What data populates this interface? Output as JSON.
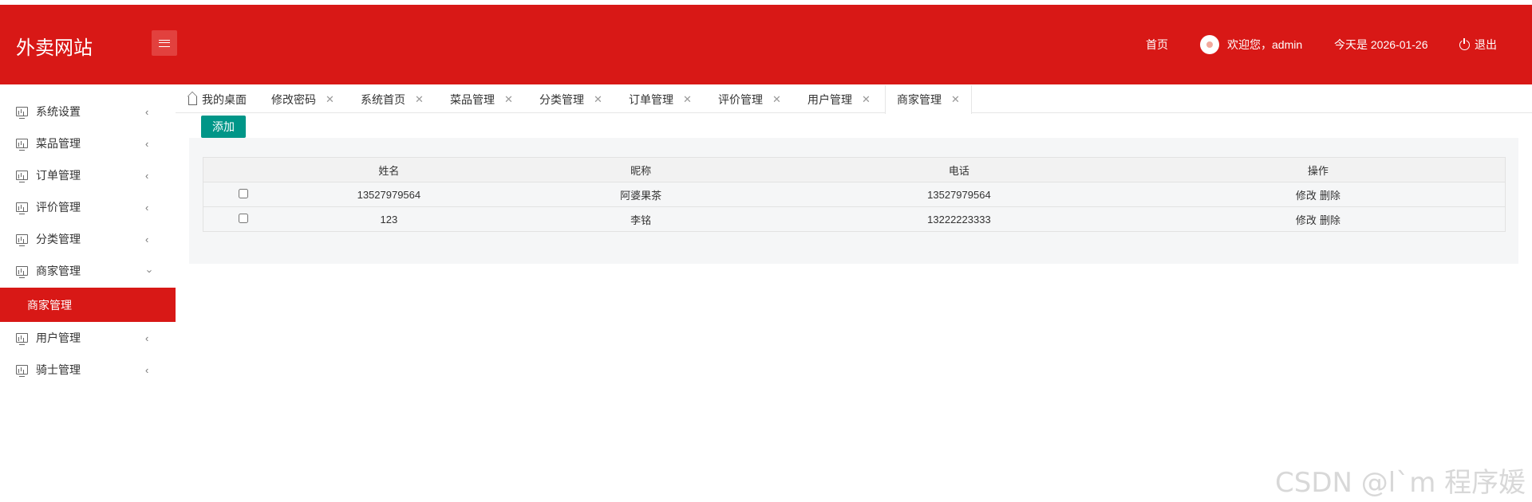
{
  "header": {
    "logo": "外卖网站",
    "home": "首页",
    "welcome": "欢迎您，admin",
    "date": "今天是 2026-01-26",
    "logout": "退出"
  },
  "sidebar": {
    "items": [
      {
        "label": "系统设置"
      },
      {
        "label": "菜品管理"
      },
      {
        "label": "订单管理"
      },
      {
        "label": "评价管理"
      },
      {
        "label": "分类管理"
      },
      {
        "label": "商家管理"
      },
      {
        "label": "用户管理"
      },
      {
        "label": "骑士管理"
      }
    ],
    "active_sub": "商家管理"
  },
  "tabs": [
    "我的桌面",
    "修改密码",
    "系统首页",
    "菜品管理",
    "分类管理",
    "订单管理",
    "评价管理",
    "用户管理",
    "商家管理"
  ],
  "toolbar": {
    "add_label": "添加"
  },
  "table": {
    "columns": [
      "姓名",
      "昵称",
      "电话",
      "操作"
    ],
    "rows": [
      {
        "name": "13527979564",
        "nickname": "阿婆果茶",
        "phone": "13527979564"
      },
      {
        "name": "123",
        "nickname": "李铭",
        "phone": "13222223333"
      }
    ],
    "actions": {
      "edit": "修改",
      "delete": "删除"
    }
  },
  "watermark": "CSDN @l`m 程序媛",
  "colors": {
    "brand": "#d81816",
    "add_button": "#009688"
  }
}
